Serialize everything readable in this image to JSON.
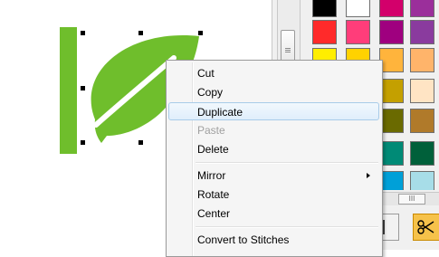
{
  "context_menu": {
    "items": [
      {
        "label": "Cut",
        "enabled": true
      },
      {
        "label": "Copy",
        "enabled": true
      },
      {
        "label": "Duplicate",
        "enabled": true,
        "highlighted": true
      },
      {
        "label": "Paste",
        "enabled": false
      },
      {
        "label": "Delete",
        "enabled": true
      },
      {
        "label": "Mirror",
        "enabled": true,
        "submenu": true
      },
      {
        "label": "Rotate",
        "enabled": true
      },
      {
        "label": "Center",
        "enabled": true
      },
      {
        "label": "Convert to Stitches",
        "enabled": true
      }
    ]
  },
  "design": {
    "leaf_color": "#6fbe2c",
    "selection_handle_color": "#000000"
  },
  "palette": {
    "colors": [
      [
        "#000000",
        "#ffffff",
        "#d3006b",
        "#9b2f9b"
      ],
      [
        "#ff2a2a",
        "#ff3d7a",
        "#9f007f",
        "#8a3b9e"
      ],
      [
        "#ffee00",
        "#ffd200",
        "#ffb43c",
        "#ffb46a"
      ],
      [
        "#ffcc00",
        "#e6b800",
        "#c4a000",
        "#ffe4c4"
      ],
      [
        "#9fb800",
        "#7f8c00",
        "#6a6a00",
        "#b07a2a"
      ],
      [
        "#007a3c",
        "#00925a",
        "#008a76",
        "#00603a"
      ],
      [
        "#1f3ea8",
        "#0a50b8",
        "#00a0d8",
        "#a7dde8"
      ]
    ]
  },
  "scrollbar": {
    "grip_icon": "scroll-grip-icon"
  },
  "horizontal_scroll": {
    "thumb_label": "III"
  },
  "tools": [
    {
      "icon": "scissors-icon"
    },
    {
      "icon": "stitch-scissors-icon"
    }
  ]
}
